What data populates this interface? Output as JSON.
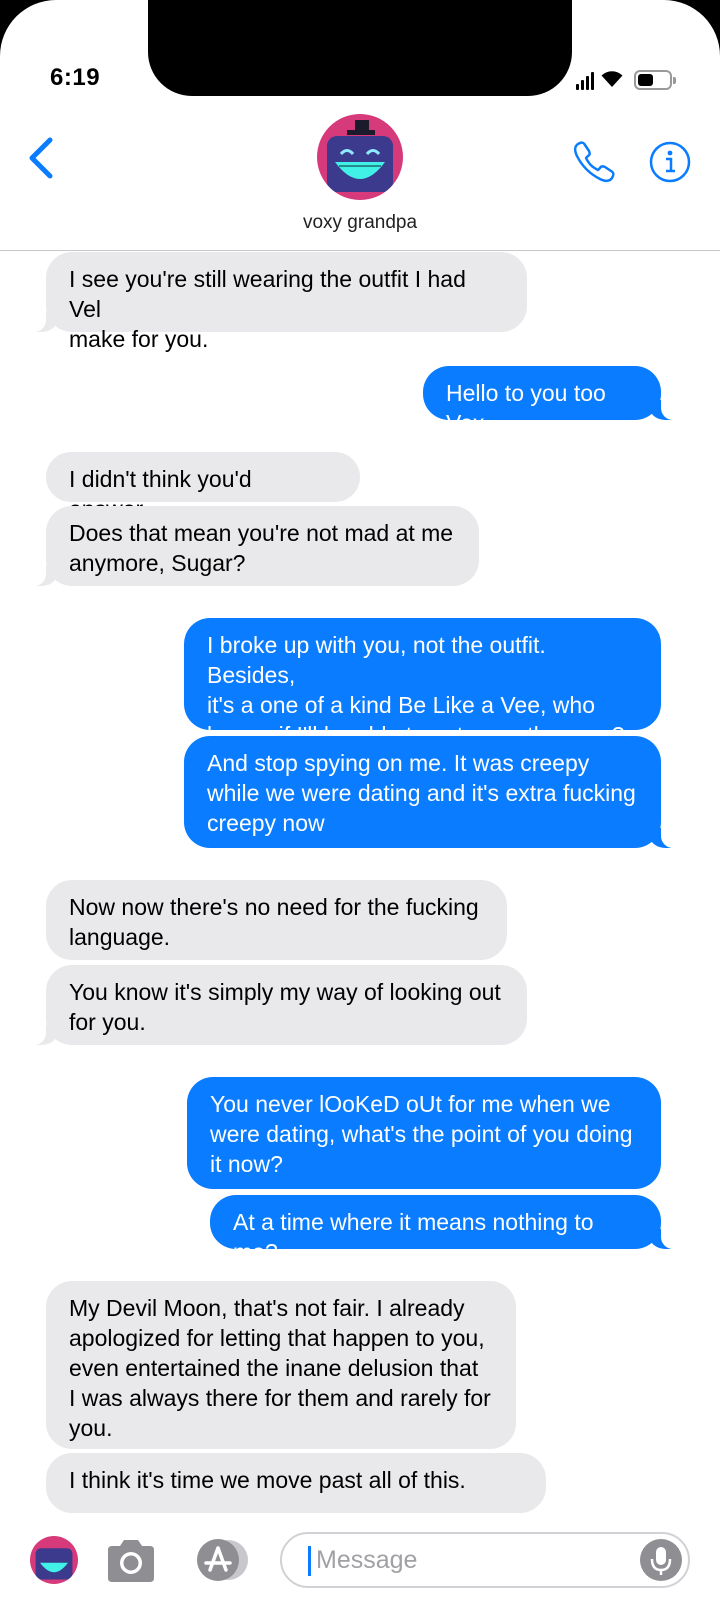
{
  "status": {
    "time": "6:19"
  },
  "contact": {
    "name": "voxy grandpa"
  },
  "messages": [
    {
      "dir": "in",
      "tail": true,
      "text": "I see you're still wearing the outfit I had Vel\nmake for you."
    },
    {
      "dir": "out",
      "tail": true,
      "text": "Hello to you too Vox"
    },
    {
      "dir": "in",
      "tail": false,
      "text": "I didn't think you'd answer."
    },
    {
      "dir": "in",
      "tail": true,
      "text": "Does that mean you're not mad at me\nanymore, Sugar?"
    },
    {
      "dir": "out",
      "tail": false,
      "text": "I broke up with you, not the outfit. Besides,\nit's a one of a kind Be Like a Vee, who\nknows if I'll be able to get a another one?"
    },
    {
      "dir": "out",
      "tail": true,
      "text": "And stop spying on me. It was creepy\nwhile we were dating and it's extra fucking\ncreepy now"
    },
    {
      "dir": "in",
      "tail": false,
      "text": "Now now there's no need for the fucking\nlanguage."
    },
    {
      "dir": "in",
      "tail": true,
      "text": "You know it's simply my way of looking out\nfor you."
    },
    {
      "dir": "out",
      "tail": false,
      "text": "You never lOoKeD oUt for me when we\nwere dating, what's the point of you doing\nit now?"
    },
    {
      "dir": "out",
      "tail": true,
      "text": "At a time where it means nothing to me?"
    },
    {
      "dir": "in",
      "tail": false,
      "text": "My Devil Moon, that's not fair. I already\napologized for letting that happen to you,\neven entertained the inane delusion that\nI was always there for them and rarely for\nyou."
    },
    {
      "dir": "in",
      "tail": false,
      "text": "I think it's time we move past all of this."
    }
  ],
  "composer": {
    "placeholder": "Message"
  },
  "colors": {
    "accent": "#0a7cff",
    "incoming_bubble": "#e9e9eb",
    "avatar_bg": "#d63a7a",
    "avatar_face": "#3b3a8c",
    "avatar_grin": "#41f0e6"
  }
}
